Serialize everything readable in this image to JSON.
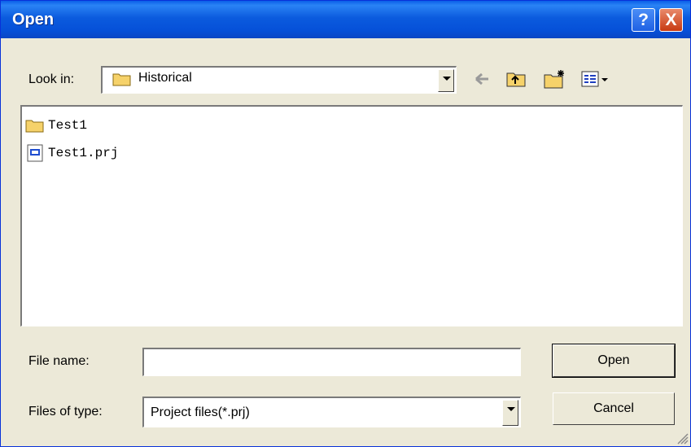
{
  "dialog": {
    "title": "Open"
  },
  "look_in": {
    "label": "Look in:",
    "value": "Historical"
  },
  "files": [
    {
      "name": "Test1",
      "kind": "folder-icon"
    },
    {
      "name": "Test1.prj",
      "kind": "project-file-icon"
    }
  ],
  "file_name": {
    "label": "File name:",
    "value": ""
  },
  "files_of_type": {
    "label": "Files of type:",
    "value": "Project files(*.prj)"
  },
  "buttons": {
    "open": "Open",
    "cancel": "Cancel"
  },
  "titlebar_buttons": {
    "help": "?",
    "close": "X"
  },
  "colors": {
    "titlebar": "#0b5bde",
    "close": "#c73a12",
    "face": "#ece9d8"
  }
}
